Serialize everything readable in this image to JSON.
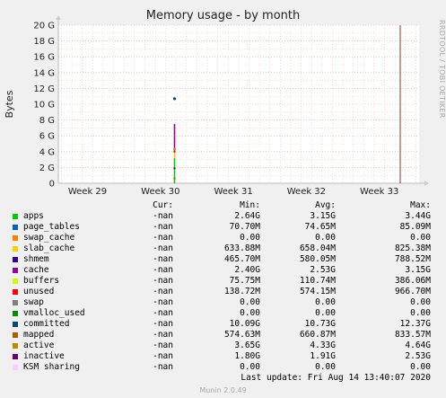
{
  "chart_data": {
    "type": "line",
    "title": "Memory usage - by month",
    "ylabel": "Bytes",
    "side_label": "RRDTOOL / TOBI OETIKER",
    "ylim": [
      0,
      20
    ],
    "y_ticks": [
      "0",
      "2 G",
      "4 G",
      "6 G",
      "8 G",
      "10 G",
      "12 G",
      "14 G",
      "16 G",
      "18 G",
      "20 G"
    ],
    "x_ticks": [
      "Week 29",
      "Week 30",
      "Week 31",
      "Week 32",
      "Week 33"
    ],
    "grid": true,
    "marker_line_label": "",
    "series": [
      {
        "name": "apps",
        "color": "#00cc00",
        "cur": "-nan",
        "min": "2.64G",
        "avg": "3.15G",
        "max": "3.44G"
      },
      {
        "name": "page_tables",
        "color": "#0066b3",
        "cur": "-nan",
        "min": "70.70M",
        "avg": "74.65M",
        "max": "85.09M"
      },
      {
        "name": "swap_cache",
        "color": "#ff8000",
        "cur": "-nan",
        "min": "0.00",
        "avg": "0.00",
        "max": "0.00"
      },
      {
        "name": "slab_cache",
        "color": "#ffcc00",
        "cur": "-nan",
        "min": "633.88M",
        "avg": "658.04M",
        "max": "825.38M"
      },
      {
        "name": "shmem",
        "color": "#330099",
        "cur": "-nan",
        "min": "465.70M",
        "avg": "580.05M",
        "max": "788.52M"
      },
      {
        "name": "cache",
        "color": "#990099",
        "cur": "-nan",
        "min": "2.40G",
        "avg": "2.53G",
        "max": "3.15G"
      },
      {
        "name": "buffers",
        "color": "#ccff00",
        "cur": "-nan",
        "min": "75.75M",
        "avg": "110.74M",
        "max": "386.06M"
      },
      {
        "name": "unused",
        "color": "#ff0000",
        "cur": "-nan",
        "min": "138.72M",
        "avg": "574.15M",
        "max": "966.70M"
      },
      {
        "name": "swap",
        "color": "#808080",
        "cur": "-nan",
        "min": "0.00",
        "avg": "0.00",
        "max": "0.00"
      },
      {
        "name": "vmalloc_used",
        "color": "#008f00",
        "cur": "-nan",
        "min": "0.00",
        "avg": "0.00",
        "max": "0.00"
      },
      {
        "name": "committed",
        "color": "#00487d",
        "cur": "-nan",
        "min": "10.09G",
        "avg": "10.73G",
        "max": "12.37G"
      },
      {
        "name": "mapped",
        "color": "#b35a00",
        "cur": "-nan",
        "min": "574.63M",
        "avg": "660.87M",
        "max": "833.57M"
      },
      {
        "name": "active",
        "color": "#b38f00",
        "cur": "-nan",
        "min": "3.65G",
        "avg": "4.33G",
        "max": "4.64G"
      },
      {
        "name": "inactive",
        "color": "#6b006b",
        "cur": "-nan",
        "min": "1.80G",
        "avg": "1.91G",
        "max": "2.53G"
      },
      {
        "name": "KSM sharing",
        "color": "#ffccff",
        "cur": "-nan",
        "min": "0.00",
        "avg": "0.00",
        "max": "0.00"
      }
    ]
  },
  "legend_headers": {
    "cur": "Cur:",
    "min": "Min:",
    "avg": "Avg:",
    "max": "Max:"
  },
  "last_update": "Last update: Fri Aug 14 13:40:07 2020",
  "footer": "Munin 2.0.49"
}
